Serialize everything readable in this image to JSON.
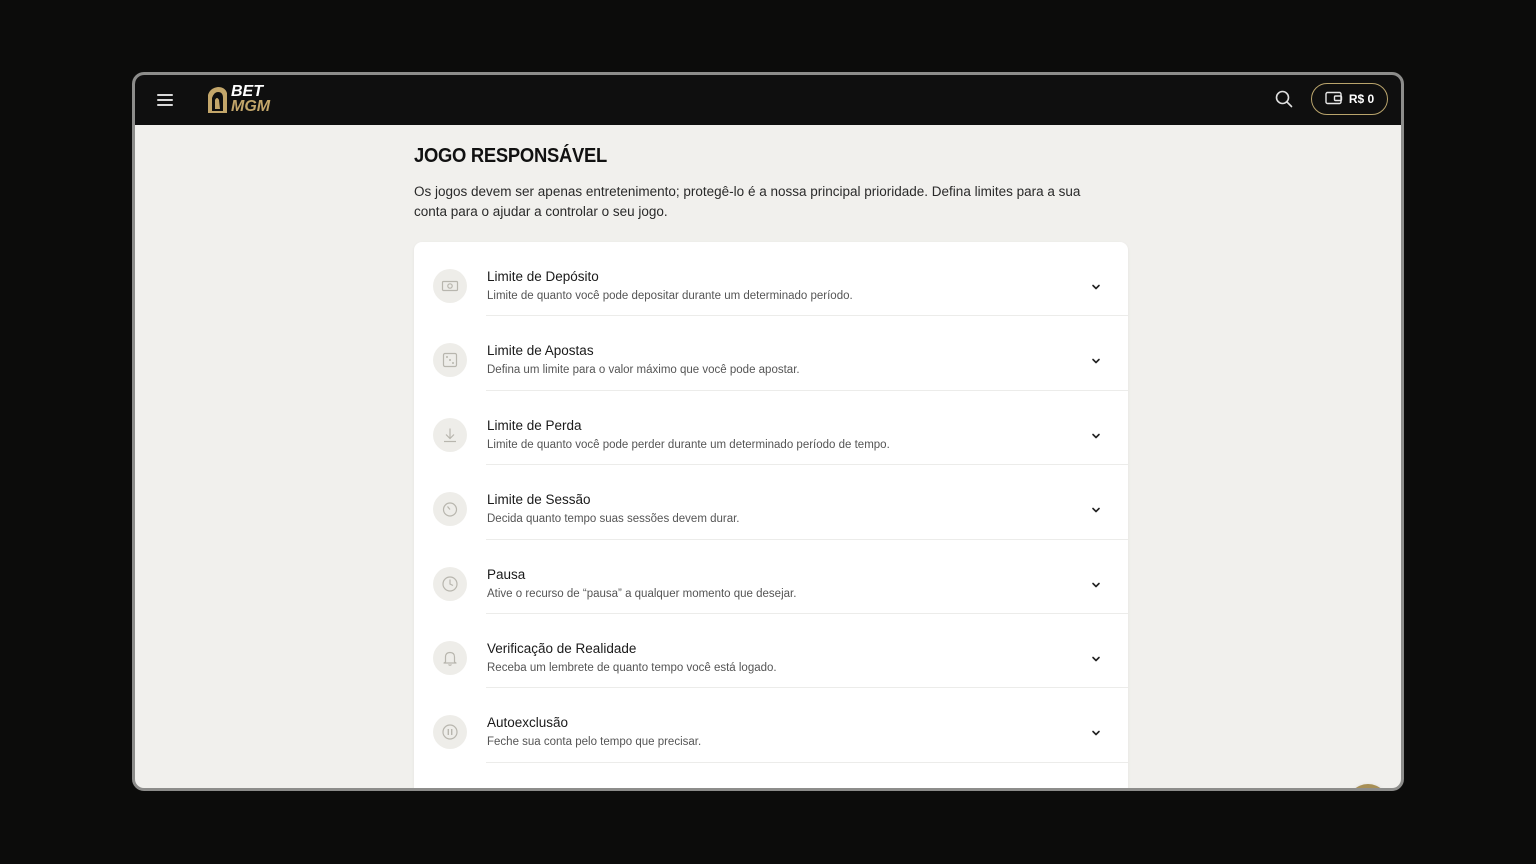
{
  "header": {
    "menu_icon": "hamburger-icon",
    "logo_line1": "BET",
    "logo_line2": "MGM",
    "search_icon": "search-icon",
    "wallet": {
      "icon": "wallet-icon",
      "balance": "R$ 0"
    }
  },
  "page": {
    "title": "JOGO RESPONSÁVEL",
    "intro": "Os jogos devem ser apenas entretenimento; protegê-lo é a nossa principal prioridade. Defina limites para a sua conta para o ajudar a controlar o seu jogo."
  },
  "options": [
    {
      "icon": "cash-icon",
      "title": "Limite de Depósito",
      "description": "Limite de quanto você pode depositar durante um determinado período."
    },
    {
      "icon": "dice-icon",
      "title": "Limite de Apostas",
      "description": "Defina um limite para o valor máximo que você pode apostar."
    },
    {
      "icon": "download-arrow-icon",
      "title": "Limite de Perda",
      "description": "Limite de quanto você pode perder durante um determinado período de tempo."
    },
    {
      "icon": "timer-icon",
      "title": "Limite de Sessão",
      "description": "Decida quanto tempo suas sessões devem durar."
    },
    {
      "icon": "clock-icon",
      "title": "Pausa",
      "description": "Ative o recurso de “pausa” a qualquer momento que desejar."
    },
    {
      "icon": "bell-icon",
      "title": "Verificação de Realidade",
      "description": "Receba um lembrete de quanto tempo você está logado."
    },
    {
      "icon": "pause-circle-icon",
      "title": "Autoexclusão",
      "description": "Feche sua conta pelo tempo que precisar."
    }
  ],
  "floating": {
    "info_icon": "info-icon",
    "chat_icon": "chat-icon"
  },
  "colors": {
    "accent_gold": "#a78f55",
    "topbar": "#0f0f0f",
    "page_bg": "#f1f0ed"
  }
}
